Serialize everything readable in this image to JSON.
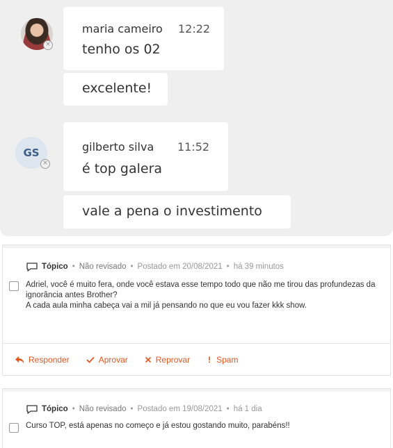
{
  "chat": {
    "groups": [
      {
        "author": "maria cameiro",
        "time": "12:22",
        "messages": [
          "tenho os 02",
          "excelente!"
        ]
      },
      {
        "author": "gilberto silva",
        "time": "11:52",
        "initials": "GS",
        "messages": [
          "é top galera",
          "vale a pena o investimento"
        ]
      }
    ]
  },
  "comments": [
    {
      "type": "Tópico",
      "status": "Não revisado",
      "posted": "Postado em 20/08/2021",
      "ago": "há 39 minutos",
      "text_line1": "Adriel, você é muito fera, onde você estava esse tempo todo que não me tirou das profundezas da",
      "text_line2": "ignorância antes Brother?",
      "text_line3": "A cada aula minha cabeça vai a mil já pensando no que eu vou fazer kkk show.",
      "actions": {
        "reply": "Responder",
        "approve": "Aprovar",
        "reject": "Reprovar",
        "spam": "Spam"
      }
    },
    {
      "type": "Tópico",
      "status": "Não revisado",
      "posted": "Postado em 19/08/2021",
      "ago": "há 1 dia",
      "text_line1": "Curso TOP, está apenas no começo e já estou gostando muito, parabéns!!"
    }
  ],
  "colors": {
    "accent": "#e2561f",
    "chat_bg": "#efefef"
  }
}
